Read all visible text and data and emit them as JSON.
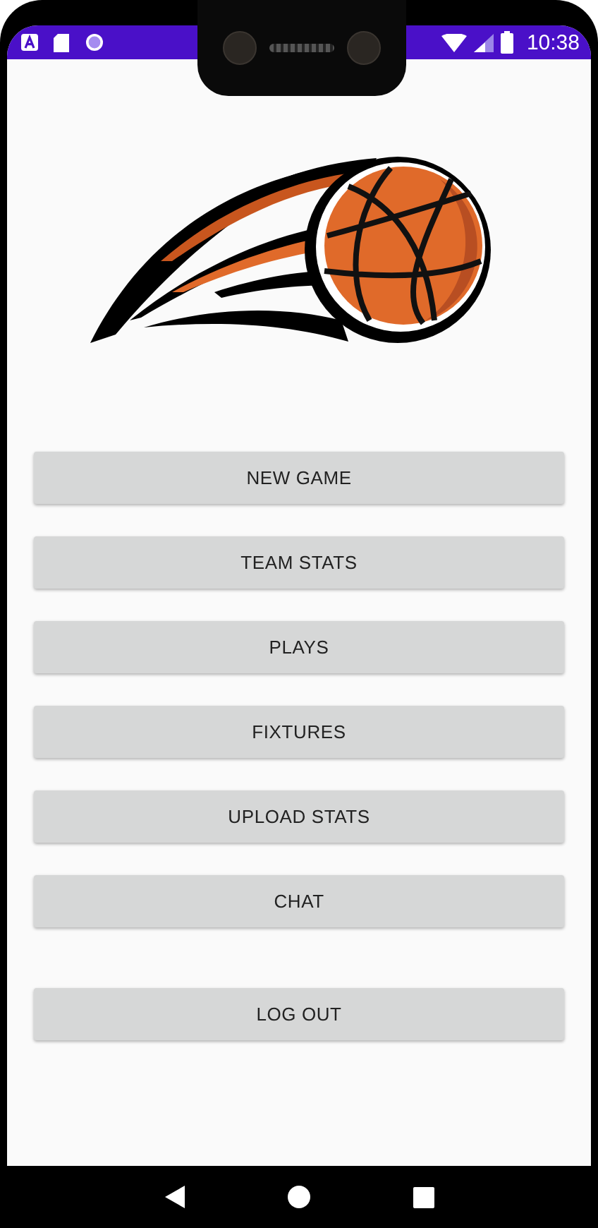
{
  "status_bar": {
    "time": "10:38"
  },
  "buttons": [
    {
      "label": "NEW GAME"
    },
    {
      "label": "TEAM STATS"
    },
    {
      "label": "PLAYS"
    },
    {
      "label": "FIXTURES"
    },
    {
      "label": "UPLOAD STATS"
    },
    {
      "label": "CHAT"
    },
    {
      "label": "LOG OUT",
      "kind": "separated"
    }
  ]
}
